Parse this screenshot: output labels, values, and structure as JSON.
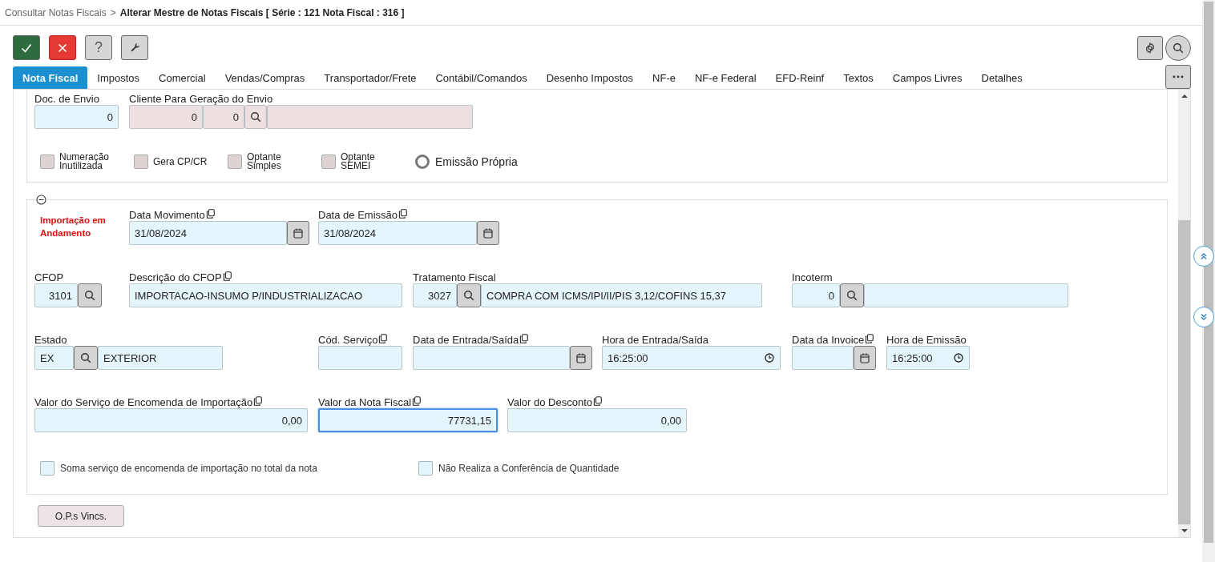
{
  "breadcrumb": {
    "parent": "Consultar Notas Fiscais",
    "separator": ">",
    "current": "Alterar Mestre de Notas Fiscais [ Série : 121 Nota Fiscal : 316 ]"
  },
  "toolbar": {
    "help_label": "?"
  },
  "tabs": [
    {
      "label": "Nota Fiscal",
      "selected": true
    },
    {
      "label": "Impostos",
      "selected": false
    },
    {
      "label": "Comercial",
      "selected": false
    },
    {
      "label": "Vendas/Compras",
      "selected": false
    },
    {
      "label": "Transportador/Frete",
      "selected": false
    },
    {
      "label": "Contábil/Comandos",
      "selected": false
    },
    {
      "label": "Desenho Impostos",
      "selected": false
    },
    {
      "label": "NF-e",
      "selected": false
    },
    {
      "label": "NF-e Federal",
      "selected": false
    },
    {
      "label": "EFD-Reinf",
      "selected": false
    },
    {
      "label": "Textos",
      "selected": false
    },
    {
      "label": "Campos Livres",
      "selected": false
    },
    {
      "label": "Detalhes",
      "selected": false
    }
  ],
  "section_1": {
    "doc_envio": {
      "label": "Doc. de Envio",
      "value": "0"
    },
    "cliente_envio": {
      "label": "Cliente Para Geração do Envio",
      "code": "0",
      "branch": "0",
      "disabled": true
    },
    "checkboxes": [
      {
        "label": "Numeração Inutilizada",
        "checked": false,
        "disabled": true
      },
      {
        "label": "Gera CP/CR",
        "checked": false,
        "disabled": true
      },
      {
        "label": "Optante Simples",
        "checked": false,
        "disabled": true
      },
      {
        "label": "Optante SEMEI",
        "checked": false,
        "disabled": true
      }
    ],
    "radio": {
      "label": "Emissão Própria",
      "selected": false
    }
  },
  "section_2": {
    "expanded": true,
    "status_message": "Importação em Andamento",
    "fields": [
      {
        "kind": "date",
        "label": "Data Movimento",
        "copy_icon": true,
        "value": "31/08/2024",
        "focused": false
      },
      {
        "kind": "date",
        "label": "Data de Emissão",
        "copy_icon": true,
        "value": "31/08/2024",
        "focused": false
      },
      {
        "kind": "lookup",
        "label": "CFOP",
        "copy_icon": false,
        "code": "3101",
        "focused": false
      },
      {
        "kind": "text",
        "label": "Descrição do CFOP",
        "copy_icon": true,
        "value": "IMPORTACAO-INSUMO P/INDUSTRIALIZACAO",
        "focused": false
      },
      {
        "kind": "lookup_named",
        "label": "Tratamento Fiscal",
        "copy_icon": false,
        "code": "3027",
        "name": "COMPRA COM ICMS/IPI/II/PIS 3,12/COFINS 15,37",
        "focused": false
      },
      {
        "kind": "lookup_named",
        "label": "Incoterm",
        "copy_icon": false,
        "code": "0",
        "focused": false
      },
      {
        "kind": "lookup_named_text",
        "label": "Estado",
        "copy_icon": false,
        "code": "EX",
        "name": "EXTERIOR",
        "focused": false
      },
      {
        "kind": "text",
        "label": "Cód. Serviço",
        "copy_icon": true,
        "focused": false
      },
      {
        "kind": "date",
        "label": "Data de Entrada/Saída",
        "copy_icon": true,
        "focused": false
      },
      {
        "kind": "time",
        "label": "Hora de Entrada/Saída",
        "copy_icon": false,
        "value": "16:25:00",
        "focused": false
      },
      {
        "kind": "date",
        "label": "Data da Invoice",
        "copy_icon": true,
        "focused": false
      },
      {
        "kind": "time",
        "label": "Hora de Emissão",
        "copy_icon": false,
        "value": "16:25:00",
        "focused": false
      },
      {
        "kind": "number",
        "label": "Valor do Serviço de Encomenda de Importação",
        "copy_icon": true,
        "value": "0,00",
        "focused": false
      },
      {
        "kind": "number",
        "label": "Valor da Nota Fiscal",
        "copy_icon": true,
        "value": "77731,15",
        "focused": true
      },
      {
        "kind": "number",
        "label": "Valor do Desconto",
        "copy_icon": true,
        "value": "0,00",
        "focused": false
      }
    ],
    "checkboxes": [
      {
        "label": "Soma serviço de encomenda de importação no total da nota",
        "checked": false,
        "disabled": false
      },
      {
        "label": "Não Realiza a Conferência de Quantidade",
        "checked": false,
        "disabled": false
      }
    ]
  },
  "ops_button": "O.P.s Vincs."
}
